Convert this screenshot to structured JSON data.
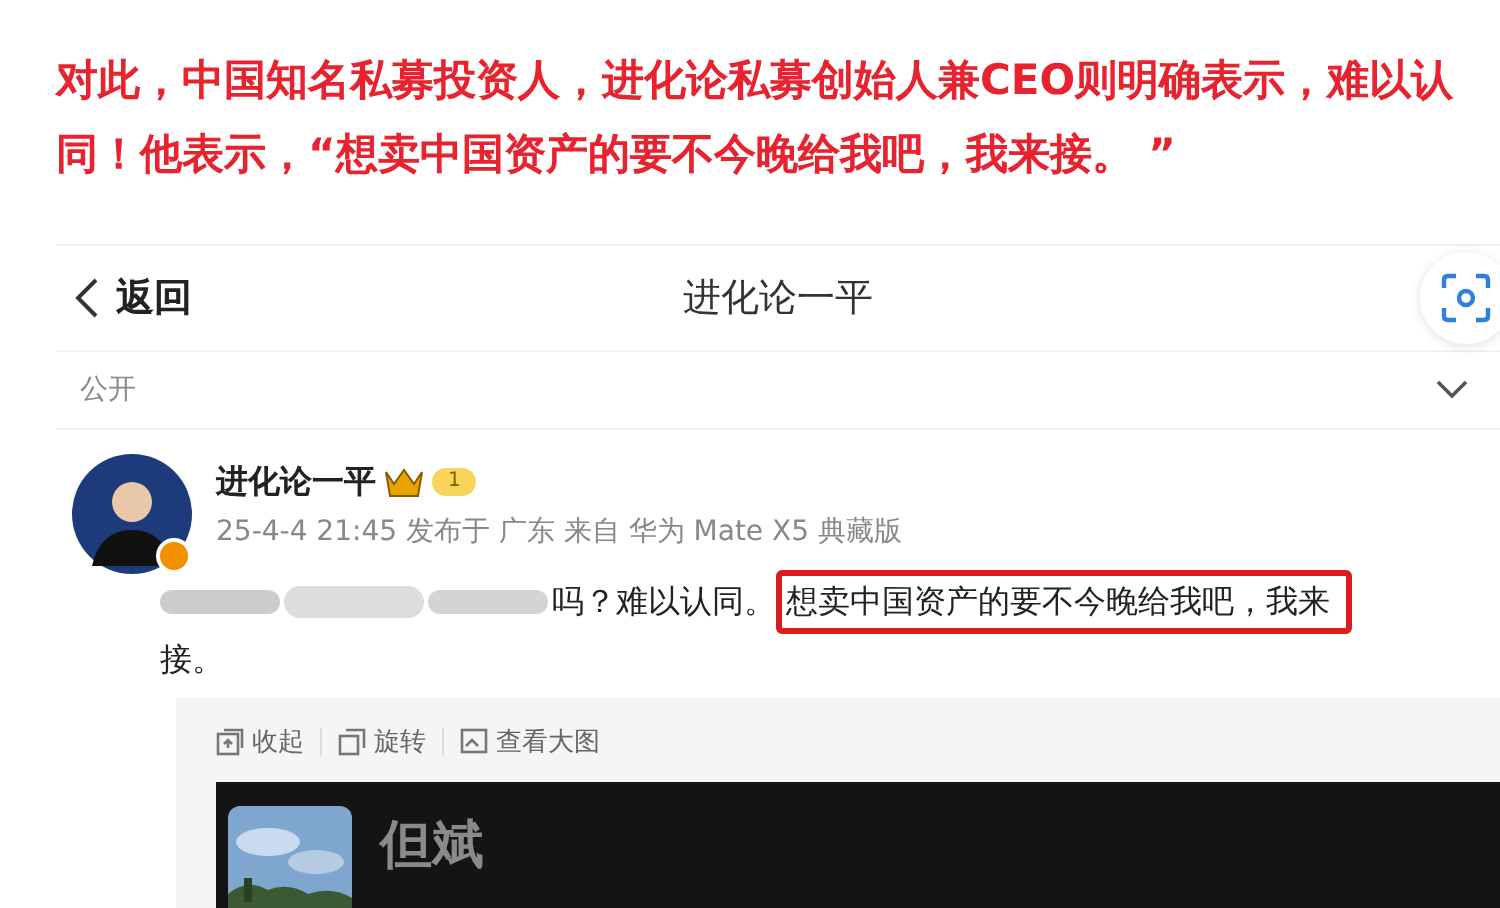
{
  "headline": "对此，中国知名私募投资人，进化论私募创始人兼CEO则明确表示，难以认同！他表示，“想卖中国资产的要不今晚给我吧，我来接。 ”",
  "nav": {
    "back": "返回",
    "title": "进化论一平"
  },
  "visibility": {
    "label": "公开",
    "expanded": false
  },
  "post": {
    "author": "进化论一平",
    "level": "1",
    "meta": "25-4-4 21:45 发布于 广东 来自 华为 Mate X5 典藏版",
    "text": "吗？难以认同。",
    "highlight": "想卖中国资产的要不今晚给我吧，我来",
    "continuation": "接。"
  },
  "image_actions": [
    {
      "label": "收起",
      "kind": "collapse"
    },
    {
      "label": "旋转",
      "kind": "rotate"
    },
    {
      "label": "查看大图",
      "kind": "enlarge"
    }
  ],
  "image": {
    "kind": "picture",
    "caption": "但斌"
  }
}
